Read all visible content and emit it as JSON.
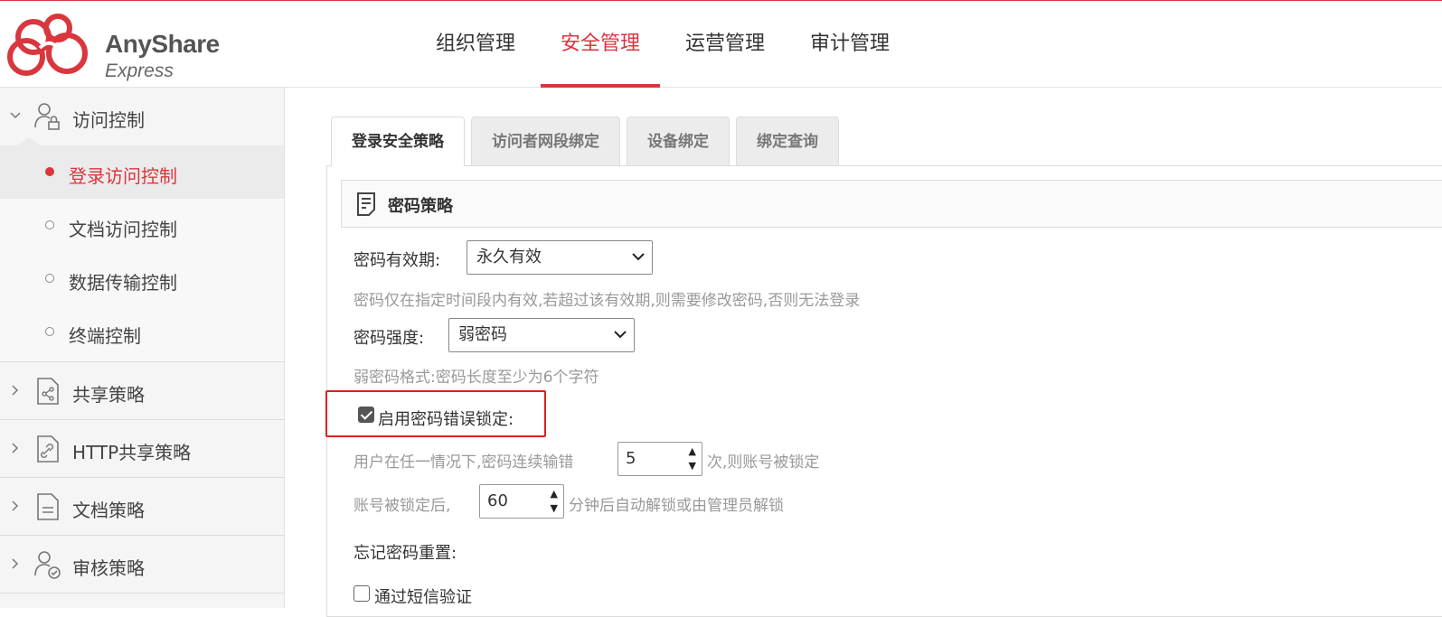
{
  "brand": {
    "name": "AnyShare",
    "sub": "Express",
    "accent": "#d9363e"
  },
  "topnav": [
    {
      "label": "组织管理",
      "active": false
    },
    {
      "label": "安全管理",
      "active": true
    },
    {
      "label": "运营管理",
      "active": false
    },
    {
      "label": "审计管理",
      "active": false
    }
  ],
  "sidebar": {
    "group_access": {
      "label": "访问控制",
      "icon": "user-lock-icon",
      "expanded": true
    },
    "items": [
      {
        "label": "登录访问控制",
        "active": true
      },
      {
        "label": "文档访问控制",
        "active": false
      },
      {
        "label": "数据传输控制",
        "active": false
      },
      {
        "label": "终端控制",
        "active": false
      }
    ],
    "groups": [
      {
        "label": "共享策略",
        "icon": "share-doc-icon"
      },
      {
        "label": "HTTP共享策略",
        "icon": "link-doc-icon"
      },
      {
        "label": "文档策略",
        "icon": "document-icon"
      },
      {
        "label": "审核策略",
        "icon": "user-check-icon"
      }
    ]
  },
  "tabs": [
    {
      "label": "登录安全策略",
      "active": true
    },
    {
      "label": "访问者网段绑定",
      "active": false
    },
    {
      "label": "设备绑定",
      "active": false
    },
    {
      "label": "绑定查询",
      "active": false
    }
  ],
  "section": {
    "title": "密码策略"
  },
  "form": {
    "expiry_label": "密码有效期:",
    "expiry_value": "永久有效",
    "expiry_hint": "密码仅在指定时间段内有效,若超过该有效期,则需要修改密码,否则无法登录",
    "strength_label": "密码强度:",
    "strength_value": "弱密码",
    "strength_hint": "弱密码格式:密码长度至少为6个字符",
    "lock_label": "启用密码错误锁定:",
    "lock_checked": true,
    "lock_pre": "用户在任一情况下,密码连续输错",
    "lock_count": "5",
    "lock_post": "次,则账号被锁定",
    "unlock_pre": "账号被锁定后,",
    "unlock_minutes": "60",
    "unlock_post": "分钟后自动解锁或由管理员解锁",
    "reset_label": "忘记密码重置:",
    "sms_label": "通过短信验证",
    "sms_checked": false
  }
}
